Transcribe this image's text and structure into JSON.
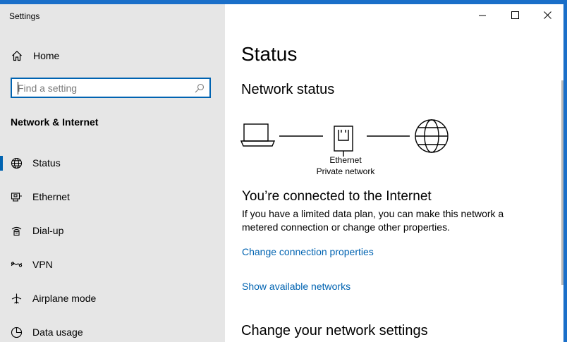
{
  "window": {
    "title": "Settings"
  },
  "sidebar": {
    "home_label": "Home",
    "search_placeholder": "Find a setting",
    "section_title": "Network & Internet",
    "items": [
      {
        "label": "Status",
        "icon": "globe-icon",
        "selected": true
      },
      {
        "label": "Ethernet",
        "icon": "ethernet-icon",
        "selected": false
      },
      {
        "label": "Dial-up",
        "icon": "dialup-icon",
        "selected": false
      },
      {
        "label": "VPN",
        "icon": "vpn-icon",
        "selected": false
      },
      {
        "label": "Airplane mode",
        "icon": "airplane-icon",
        "selected": false
      },
      {
        "label": "Data usage",
        "icon": "data-usage-icon",
        "selected": false
      }
    ]
  },
  "main": {
    "page_title": "Status",
    "network_status_heading": "Network status",
    "diagram": {
      "adapter_name": "Ethernet",
      "network_type": "Private network"
    },
    "connected_heading": "You’re connected to the Internet",
    "connected_desc": "If you have a limited data plan, you can make this network a metered connection or change other properties.",
    "link_change_connection": "Change connection properties",
    "link_show_networks": "Show available networks",
    "change_settings_heading": "Change your network settings"
  },
  "colors": {
    "accent": "#0063b1",
    "sidebar_bg": "#e6e6e6",
    "desktop_blue": "#1a6fc9"
  }
}
